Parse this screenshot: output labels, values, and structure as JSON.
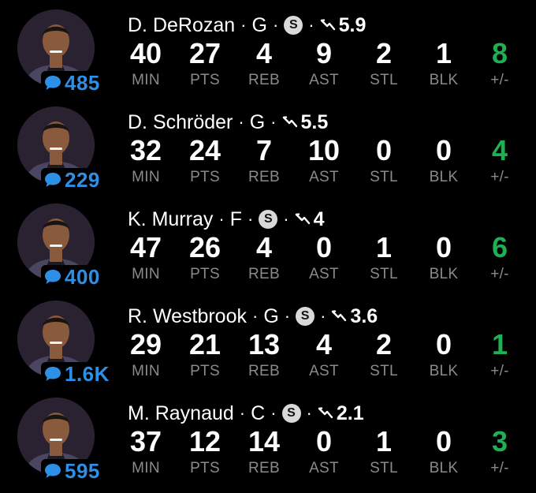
{
  "players": [
    {
      "name": "D. DeRozan",
      "position": "G",
      "starter_badge": "S",
      "trend_value": "5.9",
      "comment_count": "485",
      "stats": [
        {
          "label": "MIN",
          "value": "40"
        },
        {
          "label": "PTS",
          "value": "27"
        },
        {
          "label": "REB",
          "value": "4"
        },
        {
          "label": "AST",
          "value": "9"
        },
        {
          "label": "STL",
          "value": "2"
        },
        {
          "label": "BLK",
          "value": "1"
        },
        {
          "label": "+/-",
          "value": "8"
        }
      ]
    },
    {
      "name": "D. Schröder",
      "position": "G",
      "starter_badge": "",
      "trend_value": "5.5",
      "comment_count": "229",
      "stats": [
        {
          "label": "MIN",
          "value": "32"
        },
        {
          "label": "PTS",
          "value": "24"
        },
        {
          "label": "REB",
          "value": "7"
        },
        {
          "label": "AST",
          "value": "10"
        },
        {
          "label": "STL",
          "value": "0"
        },
        {
          "label": "BLK",
          "value": "0"
        },
        {
          "label": "+/-",
          "value": "4"
        }
      ]
    },
    {
      "name": "K. Murray",
      "position": "F",
      "starter_badge": "S",
      "trend_value": "4",
      "comment_count": "400",
      "stats": [
        {
          "label": "MIN",
          "value": "47"
        },
        {
          "label": "PTS",
          "value": "26"
        },
        {
          "label": "REB",
          "value": "4"
        },
        {
          "label": "AST",
          "value": "0"
        },
        {
          "label": "STL",
          "value": "1"
        },
        {
          "label": "BLK",
          "value": "0"
        },
        {
          "label": "+/-",
          "value": "6"
        }
      ]
    },
    {
      "name": "R. Westbrook",
      "position": "G",
      "starter_badge": "S",
      "trend_value": "3.6",
      "comment_count": "1.6K",
      "stats": [
        {
          "label": "MIN",
          "value": "29"
        },
        {
          "label": "PTS",
          "value": "21"
        },
        {
          "label": "REB",
          "value": "13"
        },
        {
          "label": "AST",
          "value": "4"
        },
        {
          "label": "STL",
          "value": "2"
        },
        {
          "label": "BLK",
          "value": "0"
        },
        {
          "label": "+/-",
          "value": "1"
        }
      ]
    },
    {
      "name": "M. Raynaud",
      "position": "C",
      "starter_badge": "S",
      "trend_value": "2.1",
      "comment_count": "595",
      "stats": [
        {
          "label": "MIN",
          "value": "37"
        },
        {
          "label": "PTS",
          "value": "12"
        },
        {
          "label": "REB",
          "value": "14"
        },
        {
          "label": "AST",
          "value": "0"
        },
        {
          "label": "STL",
          "value": "1"
        },
        {
          "label": "BLK",
          "value": "0"
        },
        {
          "label": "+/-",
          "value": "3"
        }
      ]
    }
  ],
  "icons": {
    "comment": "speech-bubble-icon",
    "trend": "trending-down-icon",
    "avatar": "player-headshot"
  },
  "colors": {
    "background": "#000000",
    "comment_count": "#2e8fe6",
    "plus_minus": "#1fb053",
    "stat_label": "#8a8a8e",
    "badge_bg": "#d9d9d9"
  }
}
